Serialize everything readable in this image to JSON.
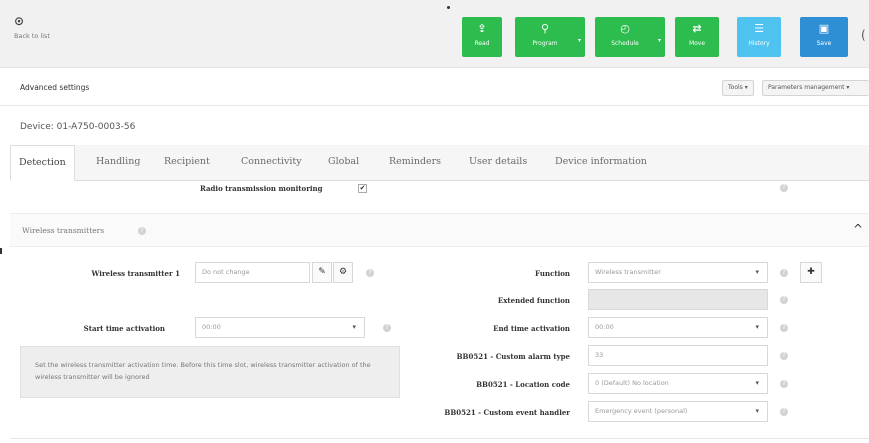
{
  "toolbar": {
    "back": {
      "icon": "arrow-circle-left-icon",
      "label": "Back to list"
    },
    "buttons": [
      {
        "id": "read",
        "label": "Read",
        "icon": "upload-icon",
        "glyph": "⇪",
        "color": "#2dbc4e"
      },
      {
        "id": "program",
        "label": "Program",
        "icon": "pin-icon",
        "glyph": "⚲",
        "color": "#2dbc4e"
      },
      {
        "id": "schedule",
        "label": "Schedule",
        "icon": "clock-icon",
        "glyph": "◴",
        "color": "#2dbc4e"
      },
      {
        "id": "move",
        "label": "Move",
        "icon": "shuffle-icon",
        "glyph": "⇄",
        "color": "#2dbc4e"
      },
      {
        "id": "history",
        "label": "History",
        "icon": "list-icon",
        "glyph": "☰",
        "color": "#4fc3f0"
      },
      {
        "id": "save",
        "label": "Save",
        "icon": "floppy-disk-icon",
        "glyph": "▣",
        "color": "#2f8fd4"
      }
    ]
  },
  "advanced": {
    "title": "Advanced settings",
    "tools_label": "Tools ▾",
    "params_label": "Parameters management ▾"
  },
  "device": {
    "title": "Device: 01-A750-0003-56"
  },
  "tabs": [
    {
      "label": "Detection",
      "active": true
    },
    {
      "label": "Handling",
      "active": false
    },
    {
      "label": "Recipient",
      "active": false
    },
    {
      "label": "Connectivity",
      "active": false
    },
    {
      "label": "Global",
      "active": false
    },
    {
      "label": "Reminders",
      "active": false
    },
    {
      "label": "User details",
      "active": false
    },
    {
      "label": "Device information",
      "active": false
    }
  ],
  "radio_monitoring": {
    "label": "Radio transmission monitoring",
    "checked": true,
    "check_glyph": "✔"
  },
  "wireless": {
    "section_title": "Wireless transmitters",
    "chevron_glyph": "^",
    "help_glyph": "?",
    "transmitter_label": "Wireless transmitter 1",
    "transmitter_placeholder": "Do not change",
    "edit_glyph": "✎",
    "gear_glyph": "⚙",
    "start_label": "Start time activation",
    "start_value": "00:00",
    "note": "Set the wireless transmitter activation time. Before this time slot, wireless transmitter activation of the wireless transmitter will be ignored",
    "function_label": "Function",
    "function_value": "Wireless transmitter",
    "add_glyph": "✚",
    "extended_label": "Extended function",
    "extended_value": "",
    "end_label": "End time activation",
    "end_value": "00:00",
    "alarm_type_label": "BB0521 - Custom alarm type",
    "alarm_type_value": "33",
    "location_label": "BB0521 - Location code",
    "location_value": "0 (Default) No location",
    "event_label": "BB0521 - Custom event handler",
    "event_value": "Emergency event (personal)",
    "caret_glyph": "▾"
  }
}
